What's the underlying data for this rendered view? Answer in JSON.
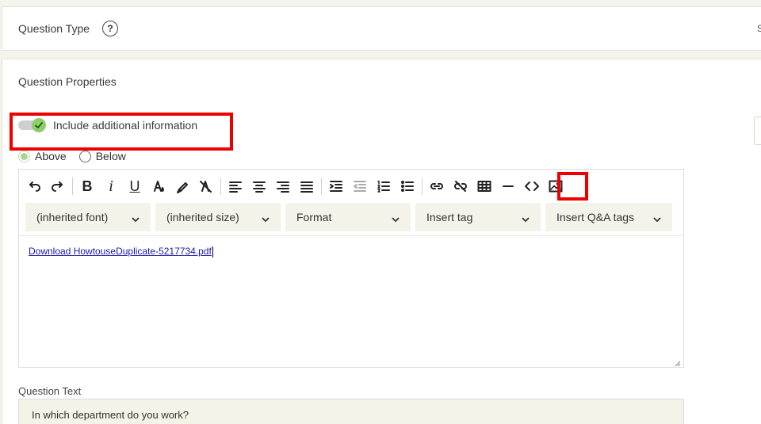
{
  "question_type": {
    "title": "Question Type",
    "help_symbol": "?",
    "edge_letter": "S"
  },
  "properties": {
    "title": "Question Properties",
    "toggle_label": "Include additional information",
    "position_options": [
      "Above",
      "Below"
    ],
    "position_selected": "Above"
  },
  "toolbar": {
    "buttons": [
      "undo-icon",
      "redo-icon",
      "bold-icon",
      "italic-icon",
      "underline-icon",
      "text-color-icon",
      "highlight-icon",
      "clear-format-icon",
      "align-left-icon",
      "align-center-icon",
      "align-right-icon",
      "align-justify-icon",
      "indent-icon",
      "outdent-icon",
      "numbered-list-icon",
      "bullet-list-icon",
      "link-icon",
      "unlink-icon",
      "table-icon",
      "horizontal-rule-icon",
      "source-code-icon",
      "image-icon"
    ],
    "bold": "B",
    "italic": "i",
    "underline": "U",
    "dropdowns": [
      "(inherited font)",
      "(inherited size)",
      "Format",
      "Insert tag",
      "Insert Q&A tags"
    ]
  },
  "editor": {
    "content_link": "Download HowtouseDuplicate-5217734.pdf"
  },
  "question_text": {
    "label": "Question Text",
    "value": "In which department do you work?"
  },
  "colors": {
    "accent_green": "#8fcc6c",
    "highlight_red": "#ee0000",
    "field_bg": "#f3f3e8"
  }
}
